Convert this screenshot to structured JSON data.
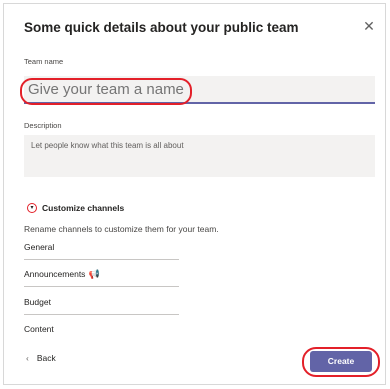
{
  "dialog": {
    "title": "Some quick details about your public team",
    "close_icon": "close-icon"
  },
  "team_name": {
    "label": "Team name",
    "placeholder": "Give your team a name"
  },
  "description": {
    "label": "Description",
    "placeholder": "Let people know what this team is all about"
  },
  "channels": {
    "section_title": "Customize channels",
    "subtitle": "Rename channels to customize them for your team.",
    "items": [
      "General",
      "Announcements",
      "Budget",
      "Content"
    ],
    "announcement_icon": "megaphone-icon"
  },
  "footer": {
    "back_label": "Back",
    "create_label": "Create"
  },
  "colors": {
    "accent": "#6264a7",
    "highlight": "#e32029"
  }
}
